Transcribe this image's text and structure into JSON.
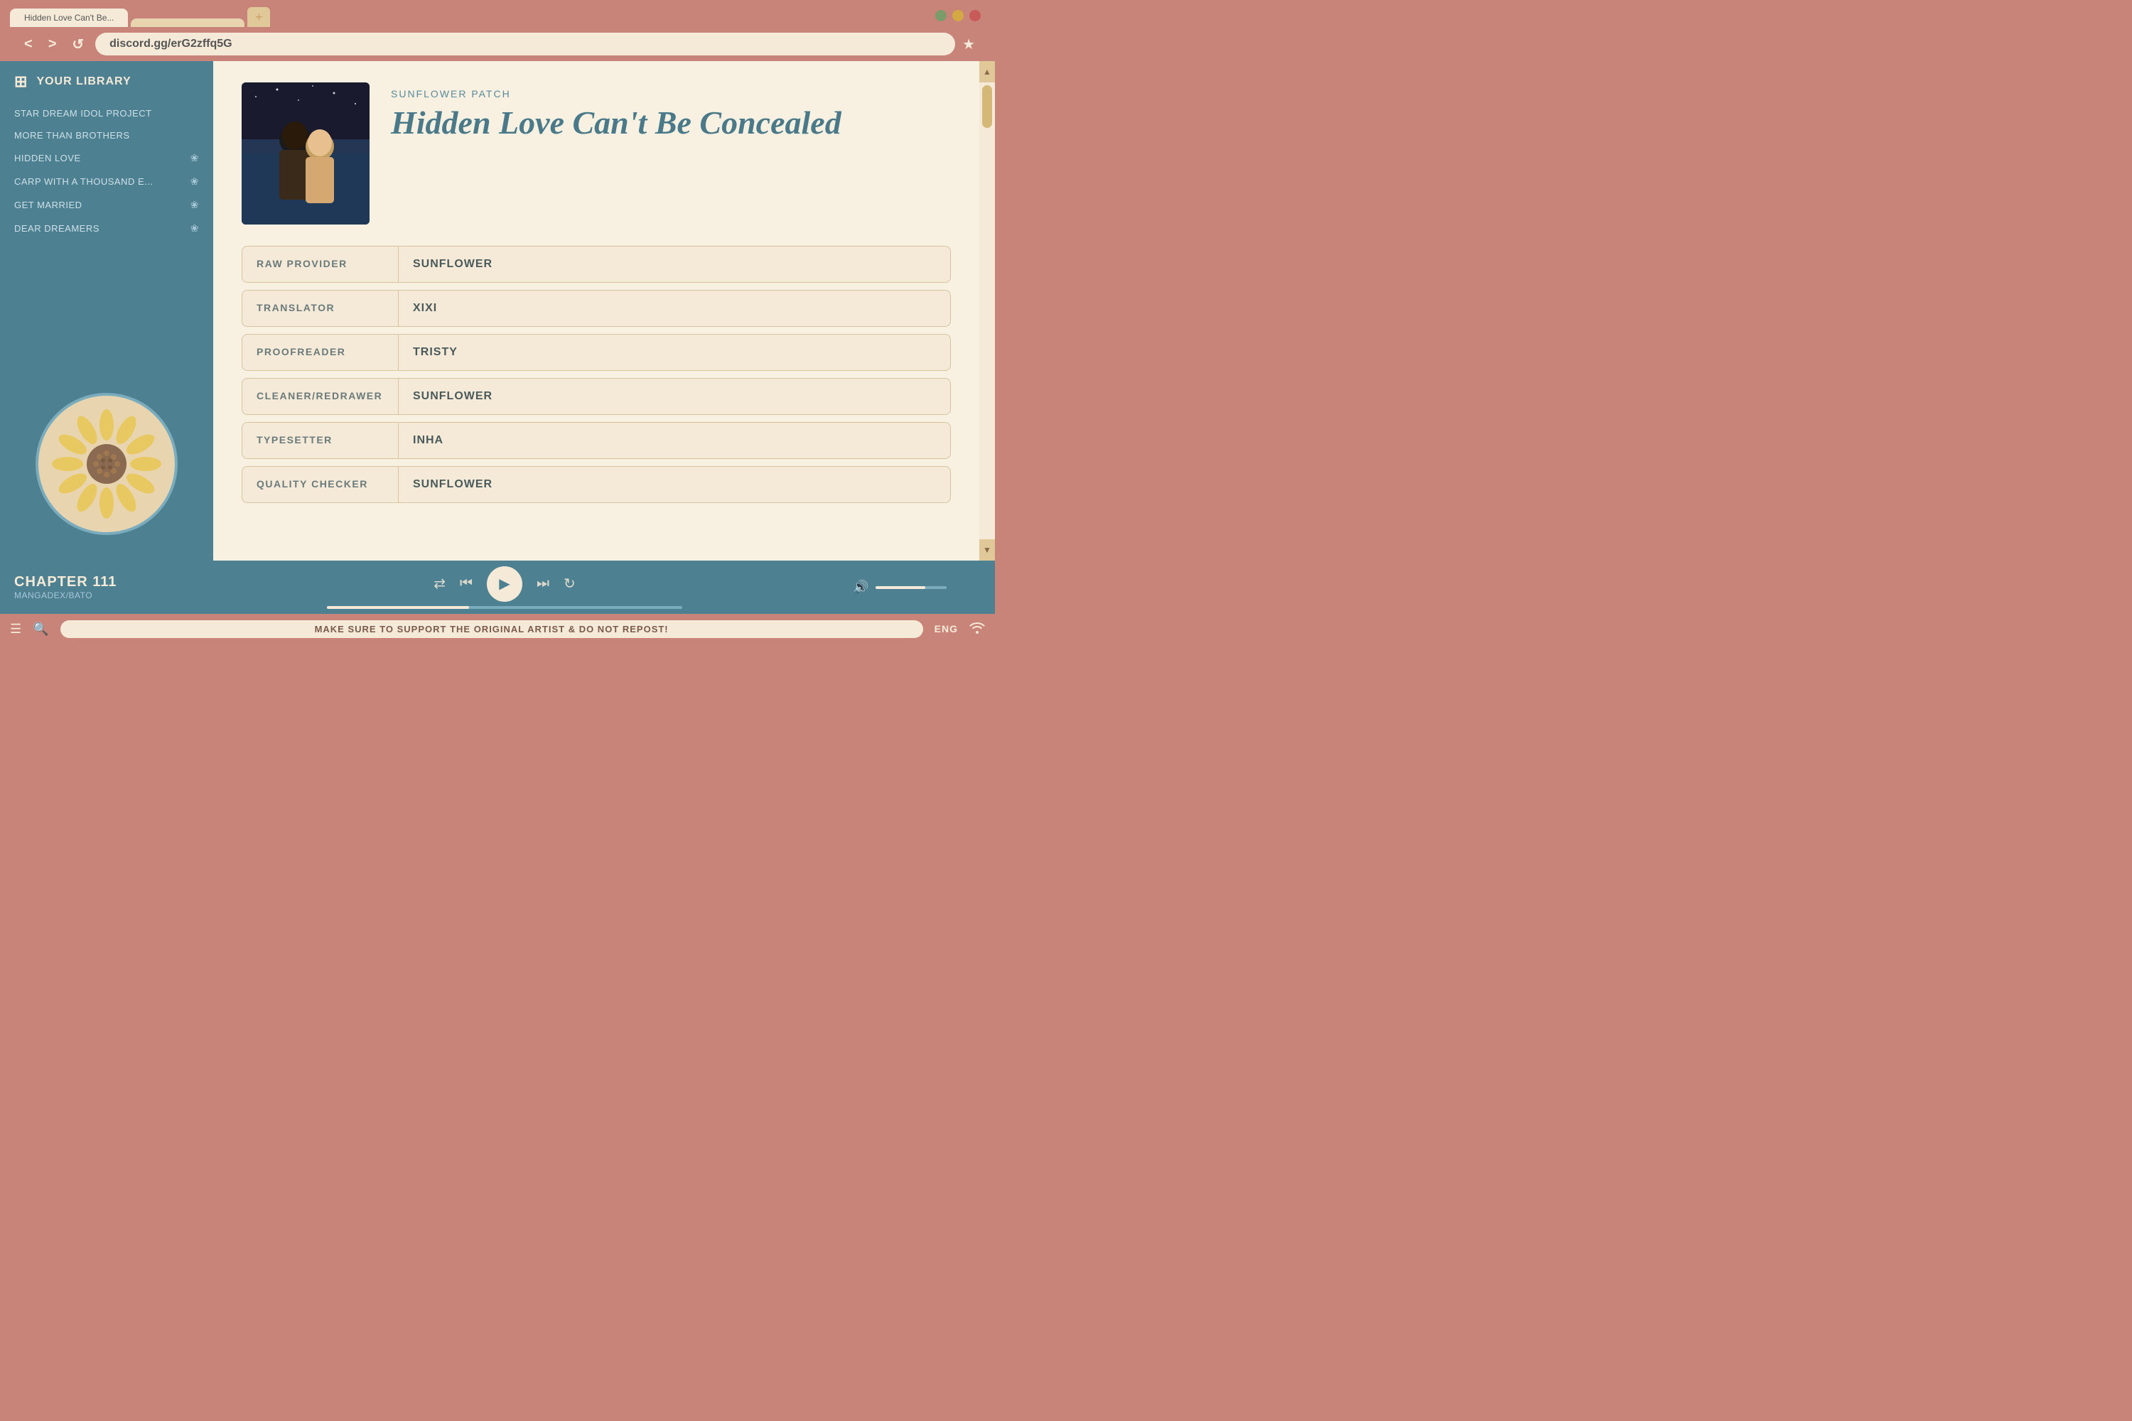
{
  "browser": {
    "tabs": [
      {
        "label": "Hidden Love Can't Be...",
        "active": true
      },
      {
        "label": "",
        "active": false
      }
    ],
    "tab_add_label": "+",
    "address": "discord.gg/erG2zffq5G",
    "back_label": "<",
    "forward_label": ">",
    "reload_label": "↺",
    "bookmark_label": "★",
    "window_controls": [
      "green",
      "yellow",
      "red"
    ]
  },
  "sidebar": {
    "header_label": "YOUR LIBRARY",
    "items": [
      {
        "label": "STAR DREAM IDOL PROJECT",
        "has_icon": false
      },
      {
        "label": "MORE THAN BROTHERS",
        "has_icon": false
      },
      {
        "label": "HIDDEN LOVE",
        "has_icon": true
      },
      {
        "label": "CARP WITH A THOUSAND E...",
        "has_icon": true
      },
      {
        "label": "GET MARRIED",
        "has_icon": true
      },
      {
        "label": "DEAR DREAMERS",
        "has_icon": true
      }
    ]
  },
  "manga": {
    "publisher": "SUNFLOWER PATCH",
    "title": "Hidden Love Can't Be Concealed",
    "credits": [
      {
        "label": "RAW PROVIDER",
        "value": "SUNFLOWER"
      },
      {
        "label": "TRANSLATOR",
        "value": "XIXI"
      },
      {
        "label": "PROOFREADER",
        "value": "TRISTY"
      },
      {
        "label": "CLEANER/REDRAWER",
        "value": "SUNFLOWER"
      },
      {
        "label": "TYPESETTER",
        "value": "INHA"
      },
      {
        "label": "QUALITY CHECKER",
        "value": "SUNFLOWER"
      }
    ]
  },
  "player": {
    "chapter": "CHAPTER 111",
    "source": "MANGADEX/BATO",
    "controls": {
      "shuffle": "⇄",
      "prev": "⏮",
      "play": "▶",
      "next": "⏭",
      "repeat": "↻"
    },
    "volume_icon": "🔊"
  },
  "bottom_bar": {
    "menu_icon": "☰",
    "search_icon": "🔍",
    "notice": "MAKE SURE TO SUPPORT THE ORIGINAL ARTIST & DO NOT REPOST!",
    "language": "ENG",
    "wifi_icon": "wifi"
  }
}
